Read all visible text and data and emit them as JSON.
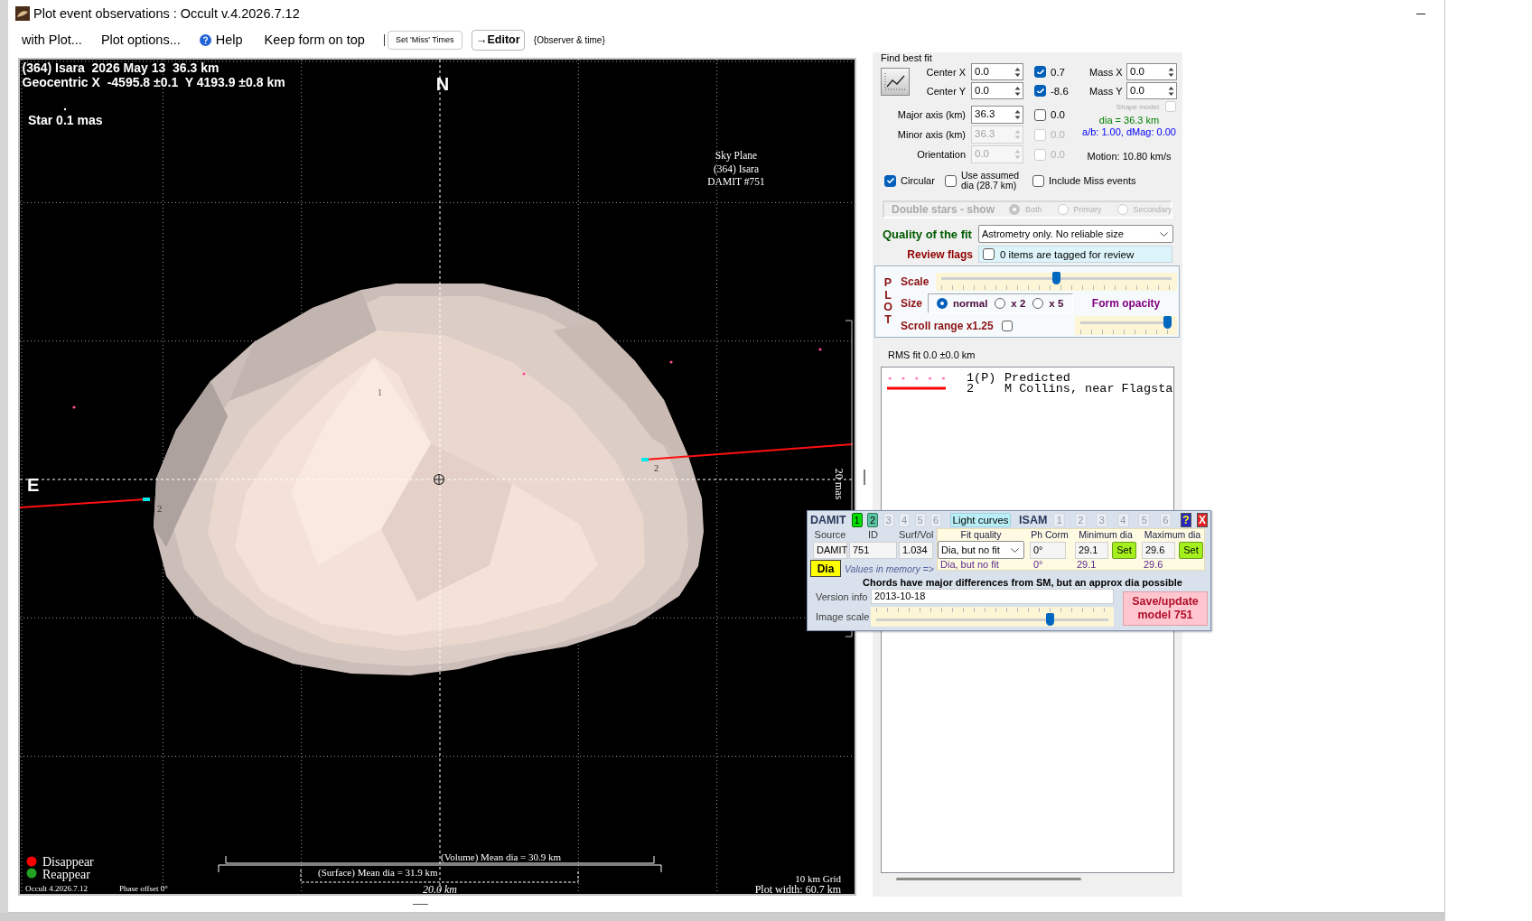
{
  "window": {
    "title": "Plot event observations : Occult v.4.2026.7.12"
  },
  "menu": [
    {
      "label": "with Plot...",
      "kind": "menu"
    },
    {
      "label": "Plot options...",
      "kind": "menu"
    },
    {
      "label": "Help",
      "kind": "help"
    },
    {
      "label": "Keep form on top",
      "kind": "menu"
    },
    {
      "label": "Set 'Miss' Times",
      "kind": "button"
    },
    {
      "label": "→Editor",
      "kind": "bold_button"
    },
    {
      "label": "{Observer & time}",
      "kind": "note"
    }
  ],
  "plot": {
    "title_lines": [
      "(364) Isara  2026 May 13  36.3 km",
      "Geocentric X  -4595.8 ±0.1  Y 4193.9 ±0.8 km"
    ],
    "star_size": "Star 0.1 mas",
    "north": "N",
    "east": "E",
    "sky_plane": [
      "Sky Plane",
      "(364) Isara",
      "DAMIT #751"
    ],
    "angular_scale": "20 mas",
    "predicted_label": "1",
    "chords": [
      {
        "label": "2"
      },
      {
        "label": "2"
      }
    ],
    "legend": [
      {
        "label": "Disappear",
        "color": "#ff0000"
      },
      {
        "label": "Reappear",
        "color": "#22a022"
      }
    ],
    "version": "Occult 4.2026.7.12",
    "phase_offset": "Phase offset 0°",
    "volume_dia": "(Volume) Mean dia = 30.9 km",
    "surface_dia": "(Surface) Mean dia = 31.9 km",
    "scale_bar": "20.0 km",
    "grid": "10 km Grid",
    "plot_width": "Plot width: 60.7 km"
  },
  "fit": {
    "title": "Find best fit",
    "params": [
      {
        "label": "Center X",
        "value": "0.0",
        "disabled": false,
        "checked": true,
        "fit_value": "0.7"
      },
      {
        "label": "Center Y",
        "value": "0.0",
        "disabled": false,
        "checked": true,
        "fit_value": "-8.6"
      },
      {
        "label": "Major axis (km)",
        "value": "36.3",
        "disabled": false,
        "checked": false,
        "fit_value": "0.0"
      },
      {
        "label": "Minor axis (km)",
        "value": "36.3",
        "disabled": true,
        "checked": false,
        "fit_value": "0.0"
      },
      {
        "label": "Orientation",
        "value": "0.0",
        "disabled": true,
        "checked": false,
        "fit_value": "0.0"
      }
    ],
    "mass": [
      {
        "label": "Mass X",
        "value": "0.0"
      },
      {
        "label": "Mass Y",
        "value": "0.0"
      }
    ],
    "shape_model": {
      "label": "Shape model",
      "checked": false,
      "disabled": true
    },
    "dia": "dia = 36.3 km",
    "ratio": "a/b: 1.00, dMag: 0.00",
    "motion": "Motion: 10.80 km/s",
    "options": [
      {
        "label": "Circular",
        "checked": true
      },
      {
        "label": "Use assumed dia (28.7 km)",
        "checked": false
      },
      {
        "label": "Include Miss events",
        "checked": false
      }
    ]
  },
  "double_stars": {
    "label": "Double stars - show",
    "disabled": true,
    "options": [
      {
        "label": "Both",
        "selected": true
      },
      {
        "label": "Primary",
        "selected": false
      },
      {
        "label": "Secondary",
        "selected": false
      }
    ]
  },
  "quality": {
    "label": "Quality of the fit",
    "value": "Astrometry only. No reliable size"
  },
  "review": {
    "label": "Review flags",
    "checked": false,
    "text": "0 items are tagged for review"
  },
  "plot_controls": {
    "title": "PLOT",
    "scale": {
      "label": "Scale",
      "level": 0.5
    },
    "size": {
      "label": "Size",
      "options": [
        {
          "label": "normal",
          "selected": true
        },
        {
          "label": "x 2",
          "selected": false
        },
        {
          "label": "x 5",
          "selected": false
        }
      ]
    },
    "opacity": {
      "label": "Form opacity",
      "level": 1
    },
    "scroll_range": {
      "label": "Scroll range x1.25",
      "checked": false
    }
  },
  "rms": "RMS fit 0.0 ±0.0 km",
  "observers": [
    {
      "id": "1(P)",
      "name": "Predicted",
      "kind": "dotted",
      "color": "#ff80c0"
    },
    {
      "id": "2",
      "name": "M Collins, near Flagsta",
      "kind": "solid",
      "color": "#ff0000"
    }
  ],
  "damit": {
    "title": "DAMIT",
    "models": [
      {
        "label": "1",
        "selected": true,
        "disabled": false
      },
      {
        "label": "2",
        "selected": false,
        "disabled": false
      },
      {
        "label": "3",
        "selected": false,
        "disabled": true
      },
      {
        "label": "4",
        "selected": false,
        "disabled": true
      },
      {
        "label": "5",
        "selected": false,
        "disabled": true
      },
      {
        "label": "6",
        "selected": false,
        "disabled": true
      }
    ],
    "light_curves": "Light curves",
    "isam_title": "ISAM",
    "isam_models": [
      {
        "label": "1",
        "selected": false,
        "disabled": true
      },
      {
        "label": "2",
        "selected": false,
        "disabled": true
      },
      {
        "label": "3",
        "selected": false,
        "disabled": true
      },
      {
        "label": "4",
        "selected": false,
        "disabled": true
      },
      {
        "label": "5",
        "selected": false,
        "disabled": true
      },
      {
        "label": "6",
        "selected": false,
        "disabled": true
      }
    ],
    "help": "?",
    "close": "X",
    "columns": [
      "Source",
      "ID",
      "Surf/Vol"
    ],
    "fields": [
      "DAMIT",
      "751",
      "1.034"
    ],
    "dia_button": "Dia",
    "memory_label": "Values in memory =>",
    "fit_headers": [
      "Fit quality",
      "Ph Corm",
      "Minimum dia",
      "Maximum dia"
    ],
    "fit_quality": "Dia, but no fit",
    "ph_corr": "0°",
    "min_dia": "29.1",
    "max_dia": "29.6",
    "set_buttons": [
      "Set",
      "Set"
    ],
    "memory": [
      "Dia, but no fit",
      "0°",
      "29.1",
      "29.6"
    ],
    "message": "Chords have major differences from SM, but an approx dia possible",
    "version_label": "Version info",
    "version": "2013-10-18",
    "image_scale": {
      "label": "Image scale",
      "level": 0.76
    },
    "save": "Save/update model 751"
  }
}
